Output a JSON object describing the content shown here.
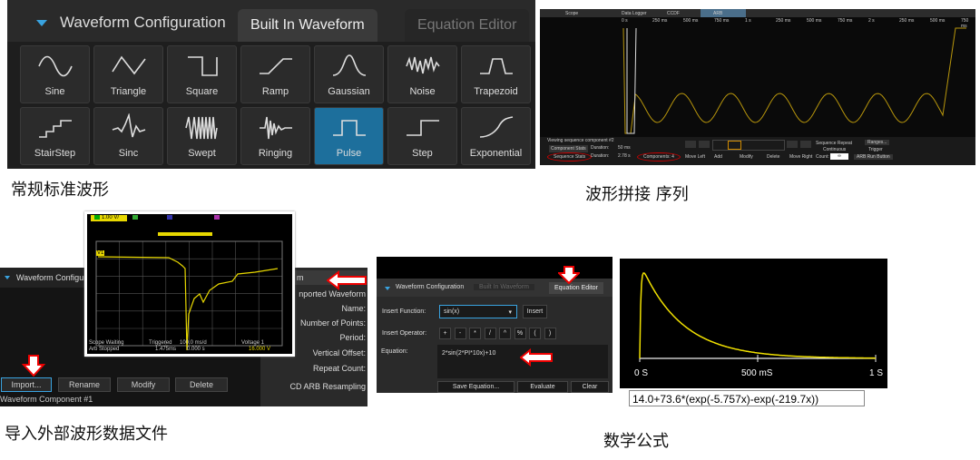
{
  "captions": {
    "standard": "常规标准波形",
    "sequence": "波形拼接 序列",
    "import": "导入外部波形数据文件",
    "math": "数学公式"
  },
  "builtin_panel": {
    "title": "Waveform Configuration",
    "tabs": [
      "Built In Waveform",
      "Equation Editor"
    ],
    "active_tab": "Built In Waveform",
    "waveforms": [
      {
        "label": "Sine",
        "icon": "sine-icon"
      },
      {
        "label": "Triangle",
        "icon": "triangle-wave-icon"
      },
      {
        "label": "Square",
        "icon": "square-wave-icon"
      },
      {
        "label": "Ramp",
        "icon": "ramp-icon"
      },
      {
        "label": "Gaussian",
        "icon": "gaussian-icon"
      },
      {
        "label": "Noise",
        "icon": "noise-icon"
      },
      {
        "label": "Trapezoid",
        "icon": "trapezoid-icon"
      },
      {
        "label": "StairStep",
        "icon": "stairstep-icon"
      },
      {
        "label": "Sinc",
        "icon": "sinc-icon"
      },
      {
        "label": "Swept",
        "icon": "swept-icon"
      },
      {
        "label": "Ringing",
        "icon": "ringing-icon"
      },
      {
        "label": "Pulse",
        "icon": "pulse-icon"
      },
      {
        "label": "Step",
        "icon": "step-icon"
      },
      {
        "label": "Exponential",
        "icon": "exponential-icon"
      }
    ],
    "selected": "Pulse",
    "accent": "#1d6f9c"
  },
  "sequence_panel": {
    "top_tabs": [
      "Scope",
      "Data Logger",
      "CCDF",
      "ARB"
    ],
    "active_tab": "ARB",
    "time_ticks": [
      "0 s",
      "250 ms",
      "500 ms",
      "750 ms",
      "1 s",
      "250 ms",
      "500 ms",
      "750 ms",
      "2 s",
      "250 ms",
      "500 ms",
      "750 ms"
    ],
    "viewing": "Viewing sequence component #2",
    "component_stats": "Component Stats",
    "sequence_stats": "Sequence Stats",
    "duration_label": "Duration:",
    "component_duration": "50 ms",
    "sequence_duration": "2.78 s",
    "components_label": "Components:",
    "components_count": "4",
    "buttons": [
      "Move Left",
      "Add",
      "Modify",
      "Delete",
      "Move Right"
    ],
    "sequence_repeat": "Sequence Repeat",
    "continuous": "Continuous",
    "count_label": "Count:",
    "count_value": "∞",
    "ranges": "Ranges...",
    "trigger": "Trigger",
    "arb_run_button": "ARB Run Button",
    "trace_color": "#b8960c"
  },
  "import_panel": {
    "title": "Waveform Configur",
    "buttons": [
      "Import...",
      "Rename",
      "Modify",
      "Delete"
    ],
    "component": "Waveform Component #1",
    "right_header": "m",
    "right_labels": [
      "nported Waveform",
      "Name:",
      "Number of Points:",
      "Period:",
      "Vertical Offset:",
      "Repeat Count:",
      "CD ARB Resampling"
    ]
  },
  "scope_overlay": {
    "channel_v1": "1.00 V/",
    "marker": "V1",
    "status1": "Scope Waiting",
    "status2": "Arb Stopped",
    "triggered": "Triggered",
    "time": "1.475ms",
    "scale": "100.0 ms/d",
    "offset": "0.000 s",
    "voltage_label": "Voltage 1",
    "voltage_value": "16.000 V"
  },
  "equation_panel": {
    "title": "Waveform Configuration",
    "tabs": [
      "Built In Waveform",
      "Equation Editor"
    ],
    "active_tab": "Equation Editor",
    "insert_function_label": "Insert Function:",
    "function_value": "sin(x)",
    "insert_button": "Insert",
    "insert_operator_label": "Insert Operator:",
    "operators": [
      "+",
      "-",
      "*",
      "/",
      "^",
      "%",
      "(",
      ")"
    ],
    "equation_label": "Equation:",
    "equation": "2*sin(2*PI*10x)+10",
    "buttons": [
      "Save Equation...",
      "Evaluate",
      "Clear"
    ]
  },
  "math_plot": {
    "x_ticks": [
      "0 S",
      "500 mS",
      "1 S"
    ],
    "formula": "14.0+73.6*(exp(-5.757x)-exp(-219.7x))",
    "trace_color": "#f0e000"
  }
}
